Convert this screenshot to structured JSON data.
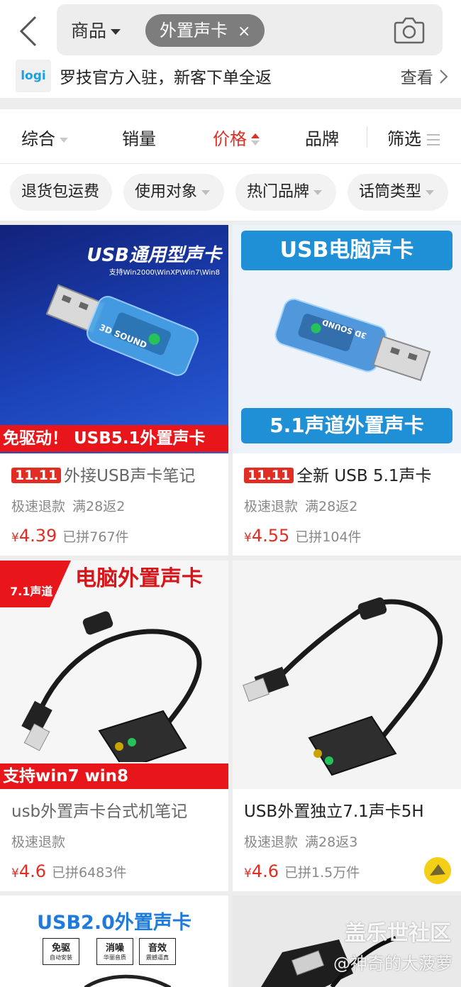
{
  "header": {
    "back_icon": "chevron-left-icon",
    "category": "商品",
    "chip": "外置声卡",
    "chip_close": "×",
    "camera_icon": "camera-icon"
  },
  "promo": {
    "logo_text": "logi",
    "text": "罗技官方入驻，新客下单全返",
    "link": "查看"
  },
  "sort_tabs": [
    {
      "label": "综合"
    },
    {
      "label": "销量"
    },
    {
      "label": "价格"
    },
    {
      "label": "品牌"
    },
    {
      "label": "筛选"
    }
  ],
  "filters": [
    {
      "label": "退货包运费"
    },
    {
      "label": "使用对象"
    },
    {
      "label": "热门品牌"
    },
    {
      "label": "话筒类型"
    }
  ],
  "accent": "#e02e24",
  "products": [
    {
      "image_headline": "USB通用型声卡",
      "image_sub": "支持Win2000\\WinXP\\Win7\\Win8",
      "image_device_label": "3D SOUND",
      "image_banner": "免驱动！ USB5.1外置声卡",
      "tag": "11.11",
      "title": "外接USB声卡笔记",
      "refund": "极速退款",
      "promo": "满28返2",
      "currency": "¥",
      "price": "4.39",
      "sold": "已拼767件"
    },
    {
      "image_headline": "USB电脑声卡",
      "image_device_label": "3D SOUND",
      "image_banner": "5.1声道外置声卡",
      "tag": "11.11",
      "title": "全新 USB 5.1声卡",
      "refund": "极速退款",
      "promo": "满28返2",
      "currency": "¥",
      "price": "4.55",
      "sold": "已拼104件"
    },
    {
      "image_headline": "电脑外置声卡",
      "image_badge": "7.1声道",
      "image_banner": "支持win7 win8",
      "title": "usb外置声卡台式机笔记",
      "refund": "极速退款",
      "currency": "¥",
      "price": "4.6",
      "sold": "已拼6483件"
    },
    {
      "title": "USB外置独立7.1声卡5H",
      "refund": "极速退款",
      "promo": "满28返3",
      "currency": "¥",
      "price": "4.6",
      "sold": "已拼1.5万件"
    },
    {
      "image_headline": "USB2.0外置声卡",
      "image_features": [
        {
          "main": "免驱",
          "sub": "自动安装"
        },
        {
          "main": "消噪",
          "sub": "华丽音质"
        },
        {
          "main": "音效",
          "sub": "震撼逼真"
        }
      ]
    }
  ],
  "watermark": {
    "line1": "盖乐世社区",
    "line2": "@神奇的大菠萝"
  }
}
